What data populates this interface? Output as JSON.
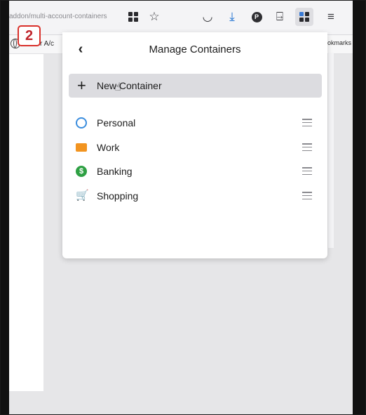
{
  "step_badge": "2",
  "toolbar": {
    "url_text": "addon/multi-account-containers",
    "profile_initial": "P"
  },
  "bookmarks": {
    "left_item": "Foxter A/c",
    "right_item": "okmarks"
  },
  "panel": {
    "title": "Manage Containers",
    "new_container_label": "New Container",
    "containers": [
      {
        "label": "Personal",
        "icon": "fingerprint-icon",
        "color": "#3a8dde"
      },
      {
        "label": "Work",
        "icon": "briefcase-icon",
        "color": "#f29420"
      },
      {
        "label": "Banking",
        "icon": "dollar-icon",
        "color": "#2ea043"
      },
      {
        "label": "Shopping",
        "icon": "cart-icon",
        "color": "#e03fb8"
      }
    ]
  }
}
